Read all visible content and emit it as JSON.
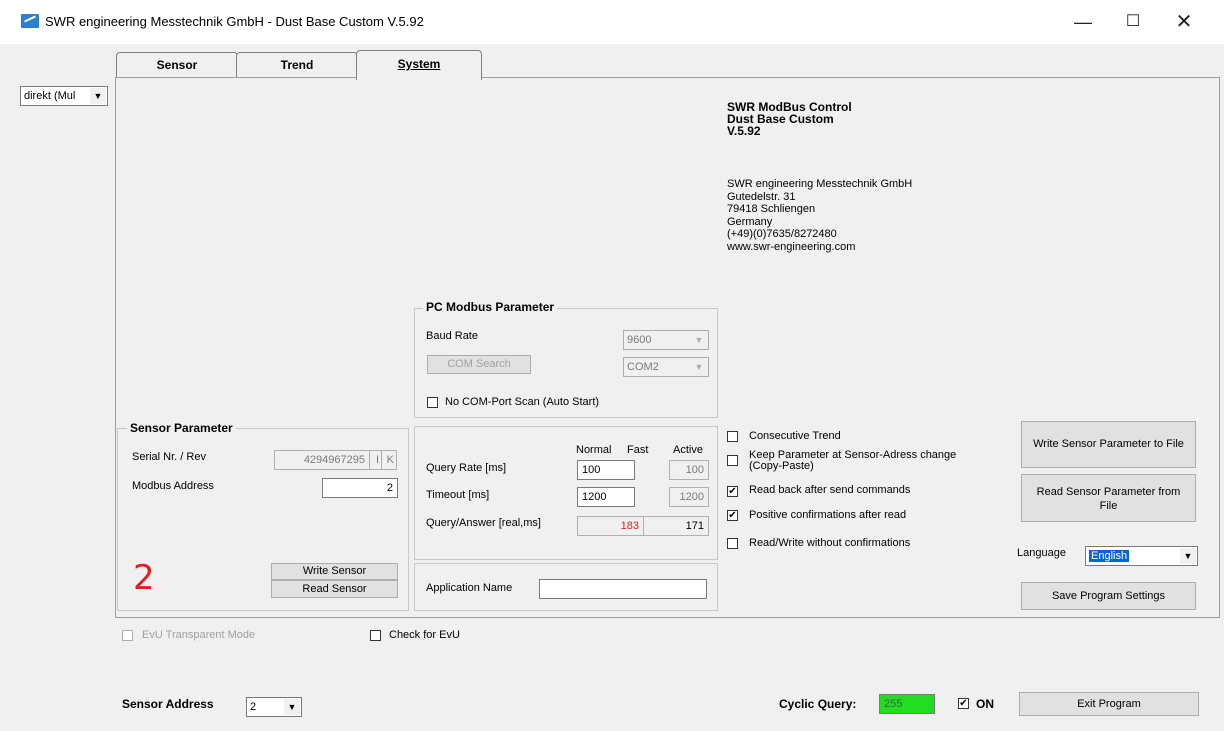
{
  "window": {
    "title": "SWR engineering Messtechnik GmbH - Dust Base Custom V.5.92",
    "minimize": "—",
    "maximize": "☐",
    "close": "✕"
  },
  "tabs": [
    {
      "label": "Sensor"
    },
    {
      "label": "Trend"
    },
    {
      "label": "System",
      "selected": true
    }
  ],
  "connection_select": {
    "value": "direkt (Mul",
    "arrow": "▼"
  },
  "about": {
    "product_line1": "SWR ModBus Control",
    "product_line2": "Dust Base Custom",
    "version": "V.5.92",
    "company": "SWR engineering Messtechnik GmbH",
    "street": "Gutedelstr. 31",
    "city": "79418 Schliengen",
    "country": "Germany",
    "phone": "(+49)(0)7635/8272480",
    "web": "www.swr-engineering.com"
  },
  "pc_modbus": {
    "title": "PC Modbus Parameter",
    "baud_label": "Baud Rate",
    "baud_value": "9600",
    "com_search_label": "COM Search",
    "com_value": "COM2",
    "no_scan_label": "No COM-Port Scan (Auto Start)",
    "no_scan_checked": false
  },
  "sensor_parameter": {
    "title": "Sensor Parameter",
    "serial_label": "Serial Nr. / Rev",
    "serial_value": "4294967295",
    "serial_rev1": "I",
    "serial_rev2": "K",
    "modbus_label": "Modbus Address",
    "modbus_value": "2",
    "big_address": "2",
    "write_label": "Write Sensor",
    "read_label": "Read Sensor"
  },
  "query": {
    "col_normal": "Normal",
    "col_fast": "Fast",
    "col_active": "Active",
    "rate_label": "Query Rate [ms]",
    "rate_normal": "100",
    "rate_active": "100",
    "timeout_label": "Timeout [ms]",
    "timeout_normal": "1200",
    "timeout_active": "1200",
    "qa_label": "Query/Answer [real,ms]",
    "qa_value1": "183",
    "qa_value2": "171"
  },
  "app_name": {
    "label": "Application Name",
    "value": ""
  },
  "options": {
    "consecutive_trend": {
      "label": "Consecutive Trend",
      "checked": false
    },
    "keep_param_line1": "Keep Parameter at Sensor-Adress change",
    "keep_param_line2": "(Copy-Paste)",
    "keep_param_checked": false,
    "read_back": {
      "label": "Read back after send commands",
      "checked": true
    },
    "positive_conf": {
      "label": "Positive confirmations after read",
      "checked": true
    },
    "rw_without": {
      "label": "Read/Write without confirmations",
      "checked": false
    }
  },
  "right_buttons": {
    "write_file": "Write Sensor Parameter to File",
    "read_file_line1": "Read Sensor Parameter from",
    "read_file_line2": "File",
    "language_label": "Language",
    "language_value": "English",
    "save_settings": "Save Program Settings"
  },
  "bottom": {
    "evu_transparent": "EvU Transparent Mode",
    "check_evu": "Check for EvU",
    "sensor_address_label": "Sensor Address",
    "sensor_address_value": "2",
    "cyclic_label": "Cyclic Query:",
    "cyclic_value": "255",
    "on_label": "ON",
    "on_checked": true,
    "exit_label": "Exit Program"
  },
  "check_mark": "✔",
  "colors": {
    "accent_red": "#e02020",
    "cyclic_green": "#22dd22",
    "selection_blue": "#0a64d8"
  }
}
